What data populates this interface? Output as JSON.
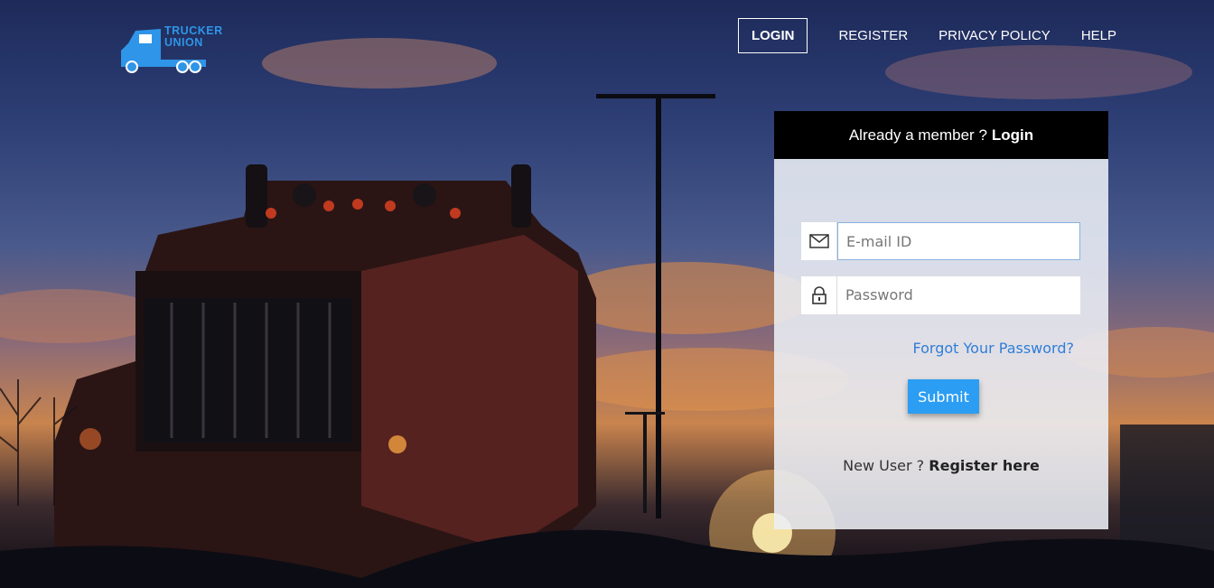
{
  "brand": {
    "name_line1": "TRUCKER",
    "name_line2": "UNION",
    "color": "#2f95e8"
  },
  "nav": {
    "items": [
      {
        "label": "LOGIN",
        "active": true
      },
      {
        "label": "REGISTER",
        "active": false
      },
      {
        "label": "PRIVACY POLICY",
        "active": false
      },
      {
        "label": "HELP",
        "active": false
      }
    ]
  },
  "login_panel": {
    "header_prefix": "Already a member ?",
    "header_bold": "Login",
    "email": {
      "placeholder": "E-mail ID",
      "value": "",
      "icon": "envelope-icon"
    },
    "password": {
      "placeholder": "Password",
      "value": "",
      "icon": "lock-icon"
    },
    "forgot_link": "Forgot Your Password?",
    "submit_label": "Submit",
    "new_user_prefix": "New User ?",
    "register_link": "Register here"
  },
  "colors": {
    "accent": "#2b9df3",
    "link": "#2f7ed8",
    "header_bg": "#000000"
  }
}
